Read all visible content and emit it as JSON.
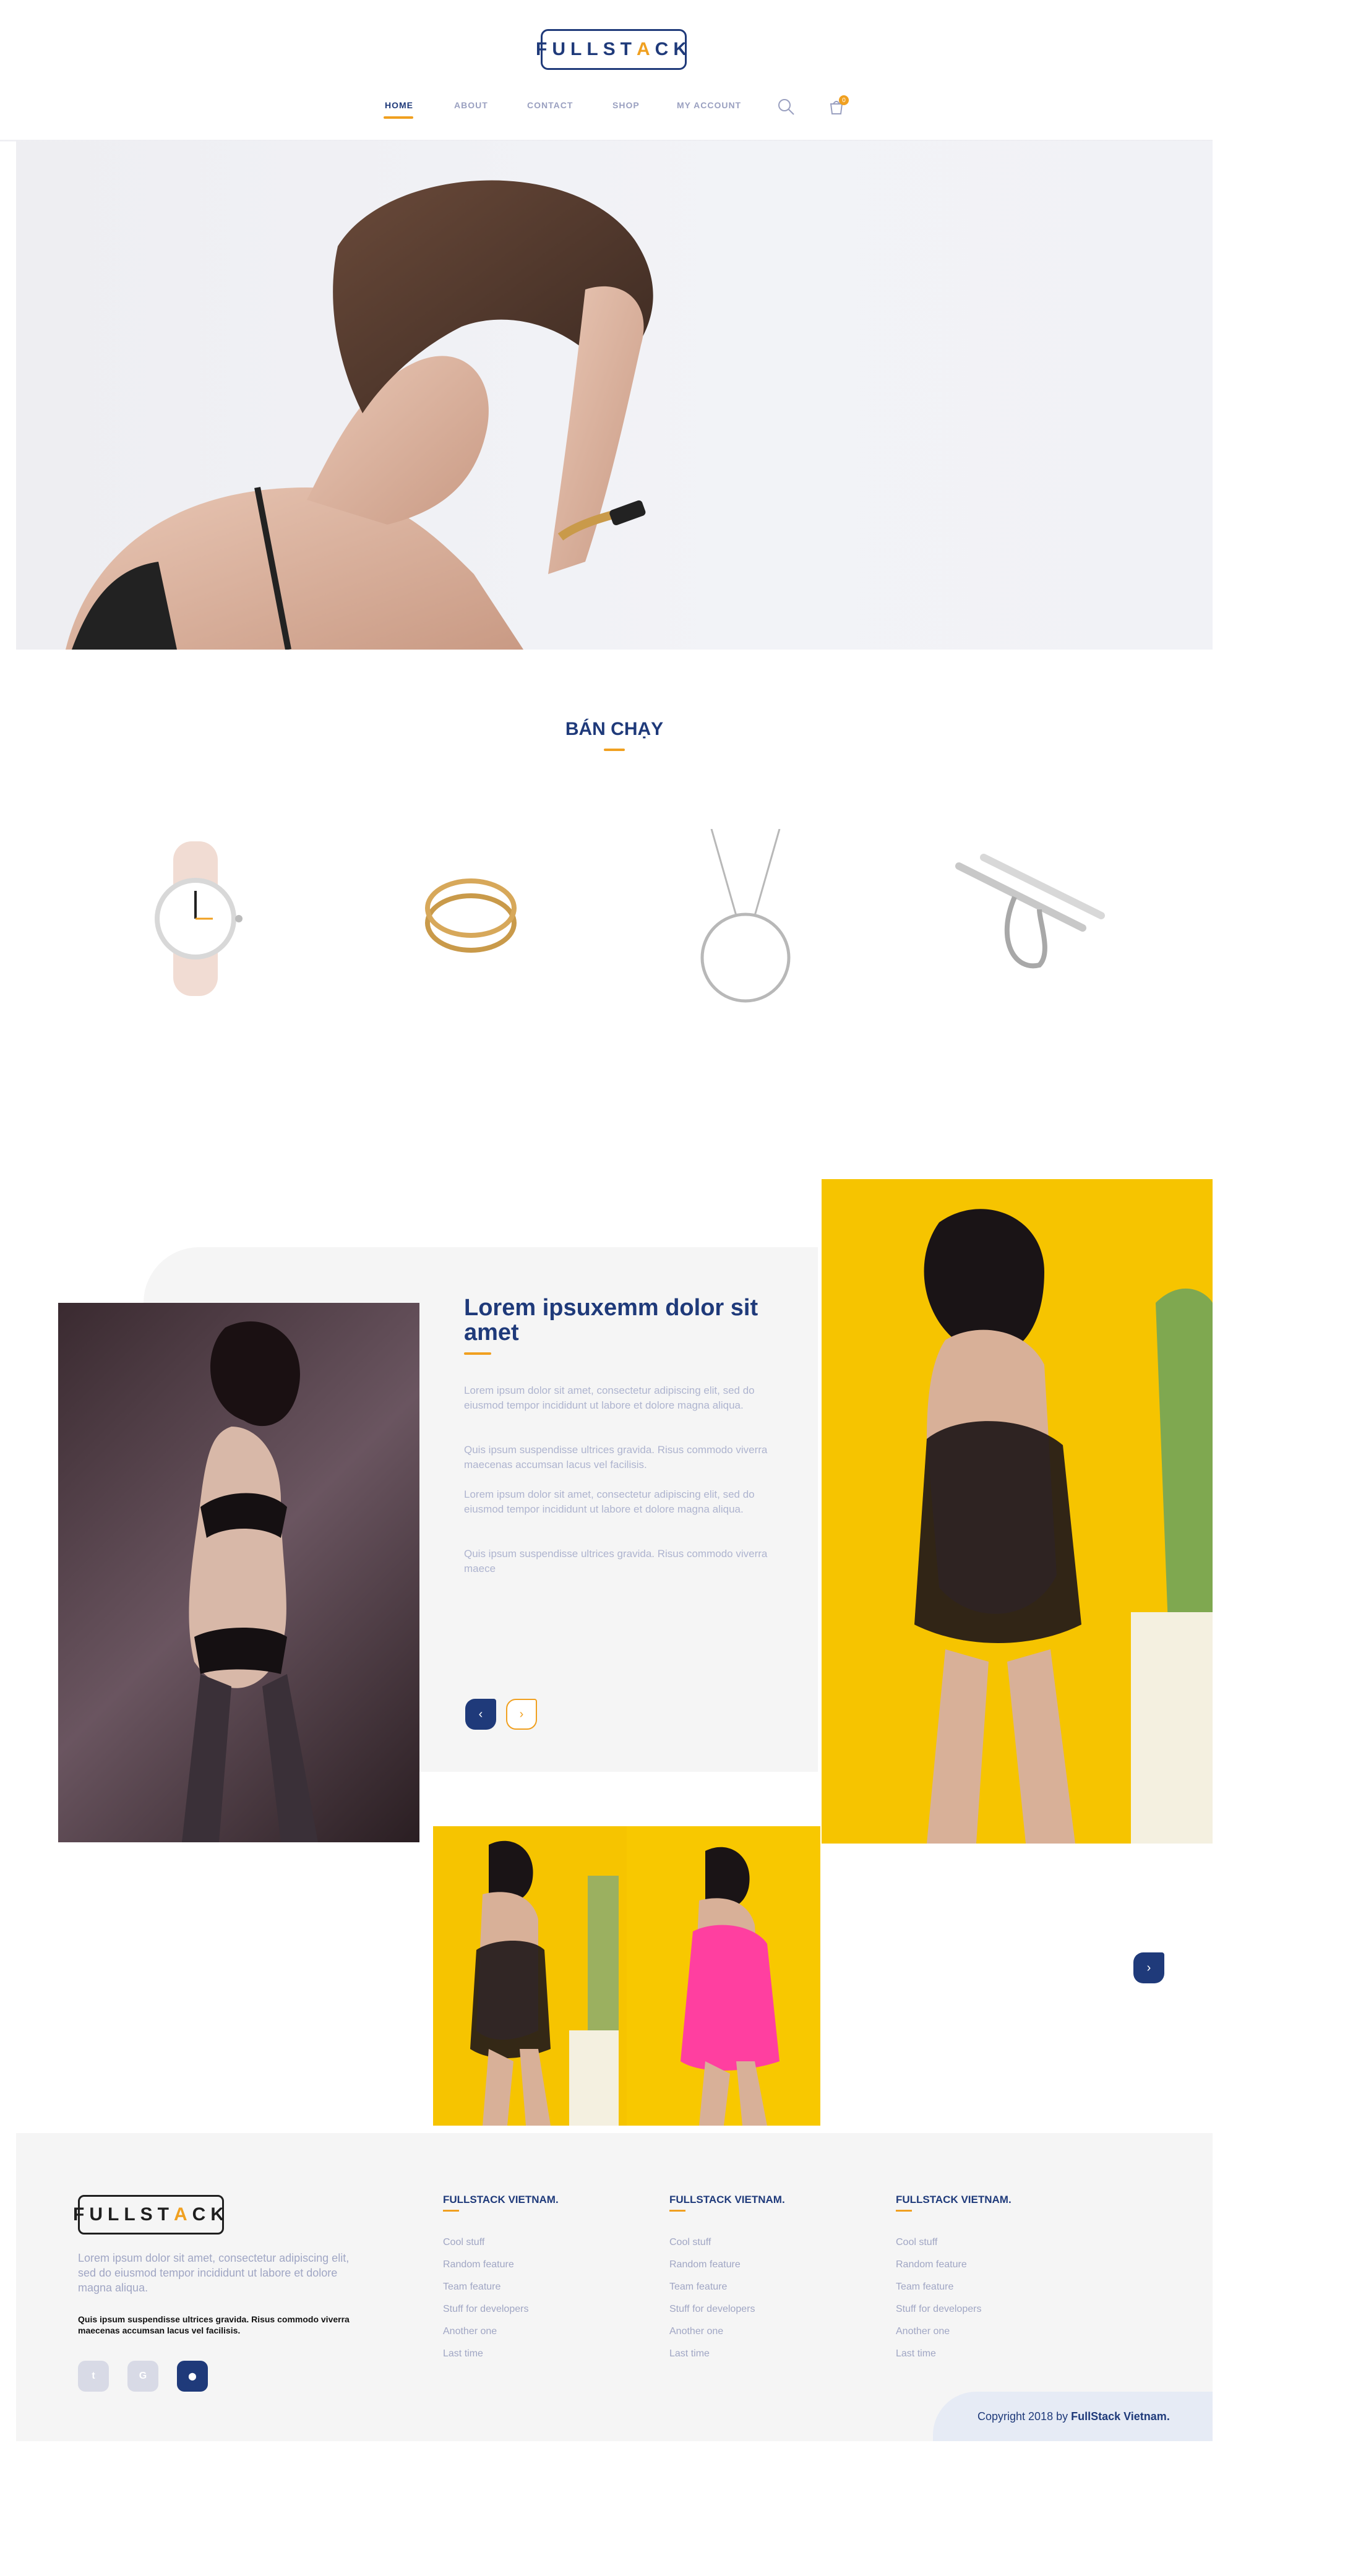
{
  "brand": {
    "name_pre": "F",
    "name_accent": "U",
    "name_post": "LLSTACK",
    "name_pre2": "",
    "logo_text_a": "FULLST",
    "logo_text_b": "A",
    "logo_text_c": "CK"
  },
  "nav": {
    "items": [
      {
        "label": "HOME",
        "active": true
      },
      {
        "label": "ABOUT"
      },
      {
        "label": "CONTACT"
      },
      {
        "label": "SHOP"
      },
      {
        "label": "MY ACCOUNT"
      }
    ],
    "search_icon": "search-icon",
    "cart_icon": "cart-icon",
    "cart_count": "0"
  },
  "bestseller": {
    "title": "BÁN CHẠY",
    "products": [
      {
        "icon": "watch"
      },
      {
        "icon": "ring-spiral"
      },
      {
        "icon": "necklace-circle"
      },
      {
        "icon": "ring-bar"
      }
    ]
  },
  "promo": {
    "title": "Lorem ipsuxemm dolor sit amet",
    "paragraphs": [
      "Lorem ipsum dolor sit amet, consectetur adipiscing elit, sed do eiusmod tempor incididunt ut labore et dolore magna aliqua.",
      "Quis ipsum suspendisse ultrices gravida. Risus commodo viverra maecenas accumsan lacus vel facilisis.",
      "Lorem ipsum dolor sit amet, consectetur adipiscing elit, sed do eiusmod tempor incididunt ut labore et dolore magna aliqua.",
      "Quis ipsum suspendisse ultrices gravida. Risus commodo viverra maece"
    ],
    "prev_symbol": "‹",
    "next_symbol": "›",
    "next_right_symbol": "›"
  },
  "footer": {
    "description": "Lorem ipsum dolor sit amet, consectetur adipiscing elit, sed do eiusmod tempor incididunt ut labore et dolore magna aliqua.",
    "bold_text": "Quis ipsum suspendisse ultrices gravida. Risus commodo viverra maecenas accumsan lacus vel facilisis.",
    "social": [
      {
        "icon": "twitter-icon",
        "glyph": "t"
      },
      {
        "icon": "google-icon",
        "glyph": "G"
      },
      {
        "icon": "github-icon",
        "glyph": "⬤"
      }
    ],
    "columns": [
      {
        "title": "FULLSTACK VIETNAM.",
        "links": [
          "Cool stuff",
          "Random feature",
          "Team feature",
          "Stuff for developers",
          "Another one",
          "Last time"
        ]
      },
      {
        "title": "FULLSTACK VIETNAM.",
        "links": [
          "Cool stuff",
          "Random feature",
          "Team feature",
          "Stuff for developers",
          "Another one",
          "Last time"
        ]
      },
      {
        "title": "FULLSTACK VIETNAM.",
        "links": [
          "Cool stuff",
          "Random feature",
          "Team feature",
          "Stuff for developers",
          "Another one",
          "Last time"
        ]
      }
    ],
    "copyright_pre": "Copyright 2018 by ",
    "copyright_brand": "FullStack Vietnam."
  },
  "colors": {
    "navy": "#1f3a7a",
    "accent": "#f0a020",
    "muted": "#a0a6c4",
    "yellow": "#f6c400",
    "pink": "#ff3fa0"
  }
}
